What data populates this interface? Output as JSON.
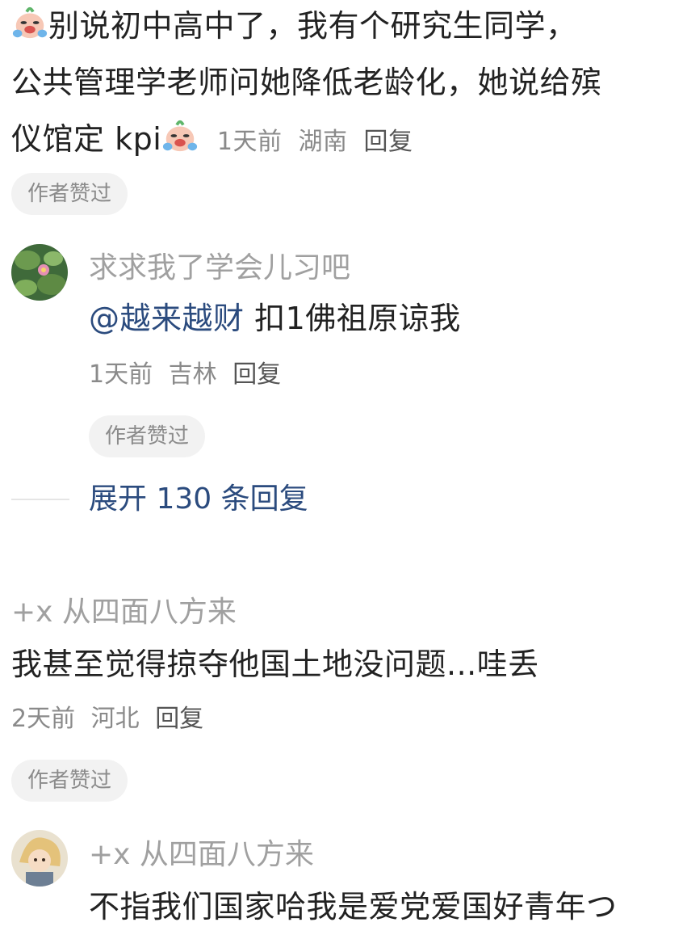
{
  "comment1": {
    "line1": "别说初中高中了，我有个研究生同学，",
    "line2": "公共管理学老师问她降低老龄化，她说给殡",
    "line3": "仪馆定 kpi",
    "time": "1天前",
    "location": "湖南",
    "reply": "回复",
    "badge": "作者赞过",
    "emoji_icon": "crying-laughing-face-icon"
  },
  "reply1": {
    "username": "求求我了学会儿习吧",
    "mention": "@越来越财",
    "text": " 扣1佛祖原谅我",
    "time": "1天前",
    "location": "吉林",
    "reply": "回复",
    "badge": "作者赞过"
  },
  "expand": {
    "label": "展开 130 条回复"
  },
  "comment2": {
    "username": "+x 从四面八方来",
    "text": "我甚至觉得掠夺他国土地没问题...哇丢",
    "time": "2天前",
    "location": "河北",
    "reply": "回复",
    "badge": "作者赞过"
  },
  "reply2": {
    "username": "+x 从四面八方来",
    "text": "不指我们国家哈我是爱党爱国好青年つ"
  },
  "colors": {
    "link": "#2b4b7e",
    "text": "#222222",
    "meta": "#8a8a8a"
  }
}
